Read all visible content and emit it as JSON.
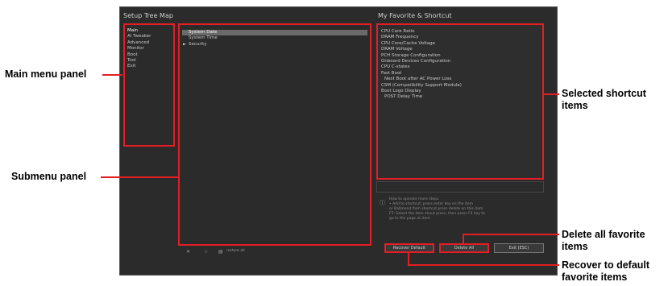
{
  "screen": {
    "left_title": "Setup Tree Map",
    "right_title": "My Favorite & Shortcut"
  },
  "main_menu": [
    "Main",
    "Ai Tweaker",
    "Advanced",
    "Monitor",
    "Boot",
    "Tool",
    "Exit"
  ],
  "submenu": [
    "System Date",
    "System Time",
    "Security"
  ],
  "shortcuts": [
    "CPU Core Ratio",
    "DRAM Frequency",
    "CPU Core/Cache Voltage",
    "DRAM Voltage",
    "PCH Storage Configuration",
    "Onboard Devices Configuration",
    "CPU C-states",
    "Fast Boot",
    "Next Boot after AC Power Loss",
    "CSM (Compatibility Support Module)",
    "Boot Logo Display",
    "POST Delay Time"
  ],
  "hint_lines": [
    "How to operate more steps",
    "• Add to shortcut: press enter key on the item",
    "  or Ballmond Item shortcut press delete on this item",
    "  F5: Select the item shaut press, then press F4 key to",
    "  go to the page at item"
  ],
  "toolbar": {
    "restore_all": "restore all"
  },
  "buttons": {
    "recover_default": "Recover Default",
    "delete_all": "Delete All",
    "exit": "Exit (ESC)"
  },
  "callouts": {
    "main_menu_panel": "Main menu panel",
    "submenu_panel": "Submenu panel",
    "selected_shortcut_1": "Selected shortcut",
    "selected_shortcut_2": "items",
    "delete_all_1": "Delete all favorite",
    "delete_all_2": "items",
    "recover_1": "Recover to default",
    "recover_2": "favorite items"
  },
  "colors": {
    "accent_red": "#e31e24",
    "screen_bg": "#2b2b2b"
  }
}
